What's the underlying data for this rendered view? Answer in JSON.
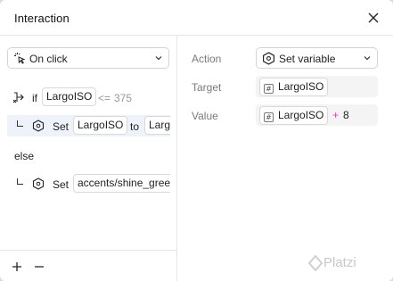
{
  "dialog": {
    "title": "Interaction"
  },
  "trigger": {
    "label": "On click"
  },
  "logic": {
    "if_row": {
      "keyword": "if",
      "variable": "LargoISO",
      "operator": "<=",
      "value": "375"
    },
    "then_row": {
      "verb": "Set",
      "variable": "LargoISO",
      "connector": "to",
      "value": "Larg"
    },
    "else_row": {
      "keyword": "else"
    },
    "else_action": {
      "verb": "Set",
      "variable": "accents/shine_gree"
    }
  },
  "footer": {
    "add_label": "+",
    "remove_label": "—"
  },
  "properties": {
    "action_label": "Action",
    "action_value": "Set variable",
    "target_label": "Target",
    "target_value": "LargoISO",
    "value_label": "Value",
    "value_variable": "LargoISO",
    "value_operator": "+",
    "value_number": "8"
  },
  "watermark": "Platzi",
  "colors": {
    "selected_row": "#eef3fb",
    "operator_pink": "#e14aa4"
  }
}
